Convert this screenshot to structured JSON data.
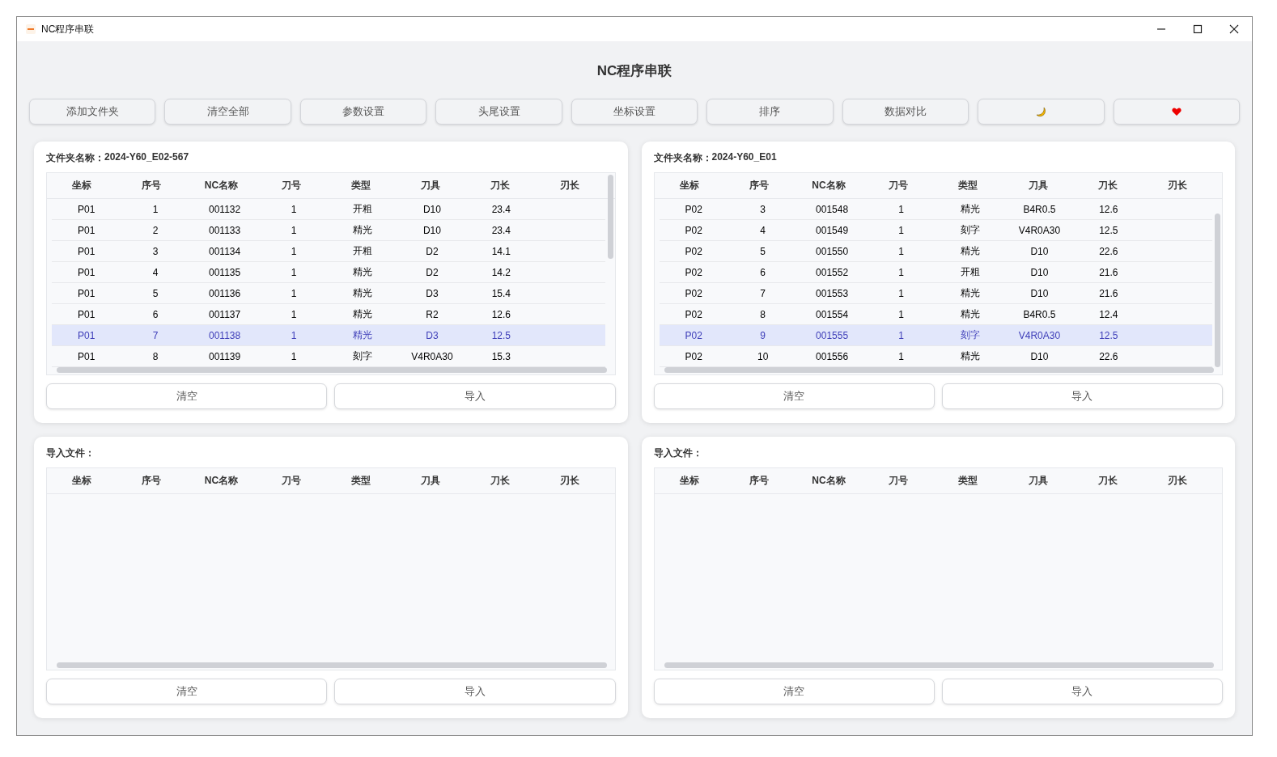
{
  "window": {
    "title": "NC程序串联"
  },
  "heading": "NC程序串联",
  "toolbar": [
    {
      "kind": "text",
      "label": "添加文件夹"
    },
    {
      "kind": "text",
      "label": "清空全部"
    },
    {
      "kind": "text",
      "label": "参数设置"
    },
    {
      "kind": "text",
      "label": "头尾设置"
    },
    {
      "kind": "text",
      "label": "坐标设置"
    },
    {
      "kind": "text",
      "label": "排序"
    },
    {
      "kind": "text",
      "label": "数据对比"
    },
    {
      "kind": "moon"
    },
    {
      "kind": "heart"
    }
  ],
  "panels": [
    {
      "label": "文件夹名称：",
      "value": "2024-Y60_E02-567",
      "columns": [
        "坐标",
        "序号",
        "NC名称",
        "刀号",
        "类型",
        "刀具",
        "刀长",
        "刃长"
      ],
      "rows": [
        {
          "cells": [
            "P01",
            "1",
            "001132",
            "1",
            "开粗",
            "D10",
            "23.4"
          ],
          "selected": false
        },
        {
          "cells": [
            "P01",
            "2",
            "001133",
            "1",
            "精光",
            "D10",
            "23.4"
          ],
          "selected": false
        },
        {
          "cells": [
            "P01",
            "3",
            "001134",
            "1",
            "开粗",
            "D2",
            "14.1"
          ],
          "selected": false
        },
        {
          "cells": [
            "P01",
            "4",
            "001135",
            "1",
            "精光",
            "D2",
            "14.2"
          ],
          "selected": false
        },
        {
          "cells": [
            "P01",
            "5",
            "001136",
            "1",
            "精光",
            "D3",
            "15.4"
          ],
          "selected": false
        },
        {
          "cells": [
            "P01",
            "6",
            "001137",
            "1",
            "精光",
            "R2",
            "12.6"
          ],
          "selected": false
        },
        {
          "cells": [
            "P01",
            "7",
            "001138",
            "1",
            "精光",
            "D3",
            "12.5"
          ],
          "selected": true
        },
        {
          "cells": [
            "P01",
            "8",
            "001139",
            "1",
            "刻字",
            "V4R0A30",
            "15.3"
          ],
          "selected": false
        }
      ],
      "buttons": [
        "清空",
        "导入"
      ]
    },
    {
      "label": "文件夹名称：",
      "value": "2024-Y60_E01",
      "columns": [
        "坐标",
        "序号",
        "NC名称",
        "刀号",
        "类型",
        "刀具",
        "刀长",
        "刃长"
      ],
      "rows": [
        {
          "cells": [
            "P02",
            "3",
            "001548",
            "1",
            "精光",
            "B4R0.5",
            "12.6"
          ],
          "selected": false
        },
        {
          "cells": [
            "P02",
            "4",
            "001549",
            "1",
            "刻字",
            "V4R0A30",
            "12.5"
          ],
          "selected": false
        },
        {
          "cells": [
            "P02",
            "5",
            "001550",
            "1",
            "精光",
            "D10",
            "22.6"
          ],
          "selected": false
        },
        {
          "cells": [
            "P02",
            "6",
            "001552",
            "1",
            "开粗",
            "D10",
            "21.6"
          ],
          "selected": false
        },
        {
          "cells": [
            "P02",
            "7",
            "001553",
            "1",
            "精光",
            "D10",
            "21.6"
          ],
          "selected": false
        },
        {
          "cells": [
            "P02",
            "8",
            "001554",
            "1",
            "精光",
            "B4R0.5",
            "12.4"
          ],
          "selected": false
        },
        {
          "cells": [
            "P02",
            "9",
            "001555",
            "1",
            "刻字",
            "V4R0A30",
            "12.5"
          ],
          "selected": true
        },
        {
          "cells": [
            "P02",
            "10",
            "001556",
            "1",
            "精光",
            "D10",
            "22.6"
          ],
          "selected": false
        }
      ],
      "buttons": [
        "清空",
        "导入"
      ]
    },
    {
      "label": "导入文件：",
      "columns": [
        "坐标",
        "序号",
        "NC名称",
        "刀号",
        "类型",
        "刀具",
        "刀长",
        "刃长"
      ],
      "buttons": [
        "清空",
        "导入"
      ]
    },
    {
      "label": "导入文件：",
      "columns": [
        "坐标",
        "序号",
        "NC名称",
        "刀号",
        "类型",
        "刀具",
        "刀长",
        "刃长"
      ],
      "buttons": [
        "清空",
        "导入"
      ]
    }
  ]
}
